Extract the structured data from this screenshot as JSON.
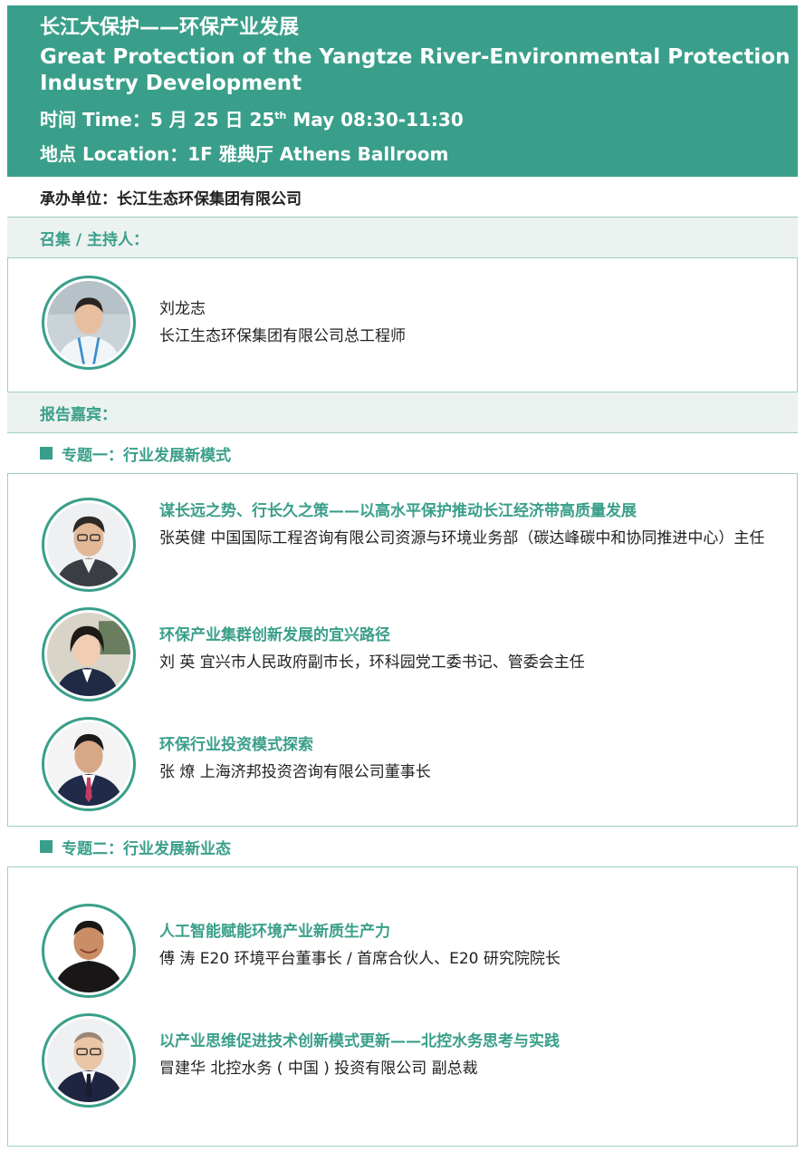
{
  "header": {
    "title_cn": "长江大保护——环保产业发展",
    "title_en": "Great Protection of the Yangtze River-Environmental Protection Industry Development",
    "time_prefix": "时间 Time：5 月 25 日 25",
    "time_sup": "th",
    "time_suffix": " May 08:30-11:30",
    "location": "地点 Location：1F 雅典厅 Athens Ballroom"
  },
  "organizer": "承办单位：长江生态环保集团有限公司",
  "host_section": {
    "label": "召集 / 主持人：",
    "host": {
      "name": "刘龙志",
      "role": "长江生态环保集团有限公司总工程师"
    }
  },
  "speakers_label": "报告嘉宾：",
  "topic1": {
    "label": "专题一：行业发展新模式",
    "speakers": [
      {
        "title": "谋长远之势、行长久之策——以高水平保护推动长江经济带高质量发展",
        "info": "张英健  中国国际工程咨询有限公司资源与环境业务部（碳达峰碳中和协同推进中心）主任"
      },
      {
        "title": "环保产业集群创新发展的宜兴路径",
        "info": "刘    英  宜兴市人民政府副市长，环科园党工委书记、管委会主任"
      },
      {
        "title": "环保行业投资模式探索",
        "info": "张    燎  上海济邦投资咨询有限公司董事长"
      }
    ]
  },
  "topic2": {
    "label": "专题二：行业发展新业态",
    "speakers": [
      {
        "title": "人工智能赋能环境产业新质生产力",
        "info": "傅    涛  E20 环境平台董事长 / 首席合伙人、E20 研究院院长"
      },
      {
        "title": "以产业思维促进技术创新模式更新——北控水务思考与实践",
        "info": "冒建华  北控水务 ( 中国 ) 投资有限公司 副总裁"
      }
    ]
  },
  "colors": {
    "accent": "#3a9f8a",
    "row_grey": "#ecf2f0",
    "border": "#9fcfc2"
  }
}
